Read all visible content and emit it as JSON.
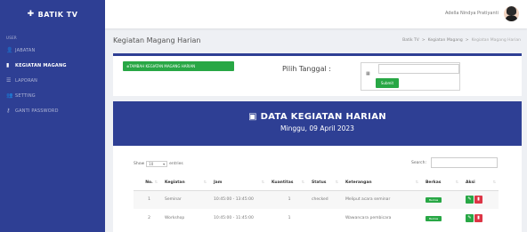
{
  "brand": {
    "icon": "plus-icon",
    "name": "BATIK TV"
  },
  "sidebar": {
    "heading": "USER",
    "items": [
      {
        "label": "JABATAN",
        "icon": "user-icon"
      },
      {
        "label": "KEGIATAN MAGANG",
        "icon": "book-icon"
      },
      {
        "label": "LAPORAN",
        "icon": "list-icon"
      },
      {
        "label": "SETTING",
        "icon": "users-icon"
      },
      {
        "label": "GANTI PASSWORD",
        "icon": "key-icon"
      }
    ]
  },
  "topbar": {
    "user_name": "Adella Nindya Pratiyanti"
  },
  "page": {
    "title": "Kegiatan Magang Harian",
    "breadcrumb": [
      "Batik TV",
      ">",
      "Kegiatan Magang",
      ">",
      "Kegiatan Magang Harian"
    ]
  },
  "filter": {
    "add_button": "TAMBAH KEGIATAN MAGANG HARIAN",
    "date_label": "Pilih Tanggal :",
    "date_value": "",
    "submit_label": "Submit"
  },
  "banner": {
    "title": "DATA KEGIATAN HARIAN",
    "date": "Minggu, 09 April 2023"
  },
  "table": {
    "show_label": "Show",
    "show_value": "10",
    "entries_label": "entries",
    "search_label": "Search:",
    "search_value": "",
    "columns": [
      "No.",
      "Kegiatan",
      "Jam",
      "Kuantitas",
      "Status",
      "Keterangan",
      "Berkas",
      "Aksi"
    ],
    "rows": [
      {
        "no": "1",
        "kegiatan": "Seminar",
        "jam": "10:45:00 - 13:45:00",
        "kuantitas": "1",
        "status": "checked",
        "keterangan": "Meliput acara seminar",
        "berkas": "Berkas"
      },
      {
        "no": "2",
        "kegiatan": "Workshop",
        "jam": "10:45:00 - 11:45:00",
        "kuantitas": "1",
        "status": "",
        "keterangan": "Wawancara pembicara",
        "berkas": "Berkas"
      }
    ]
  },
  "colors": {
    "primary": "#2e3f94",
    "success": "#28a745",
    "danger": "#dc3545"
  }
}
